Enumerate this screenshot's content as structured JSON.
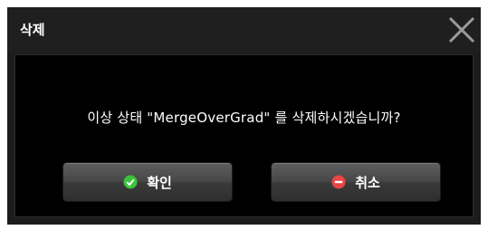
{
  "dialog": {
    "title": "삭제",
    "message": "이상 상태 \"MergeOverGrad\" 를 삭제하시겠습니까?",
    "buttons": {
      "confirm_label": "확인",
      "cancel_label": "취소"
    },
    "icons": {
      "close": "close-icon",
      "confirm": "check-circle-icon",
      "cancel": "minus-circle-icon"
    },
    "colors": {
      "confirm_icon": "#3cc23c",
      "cancel_icon": "#e84646",
      "close_icon": "#9a9a9a"
    }
  }
}
